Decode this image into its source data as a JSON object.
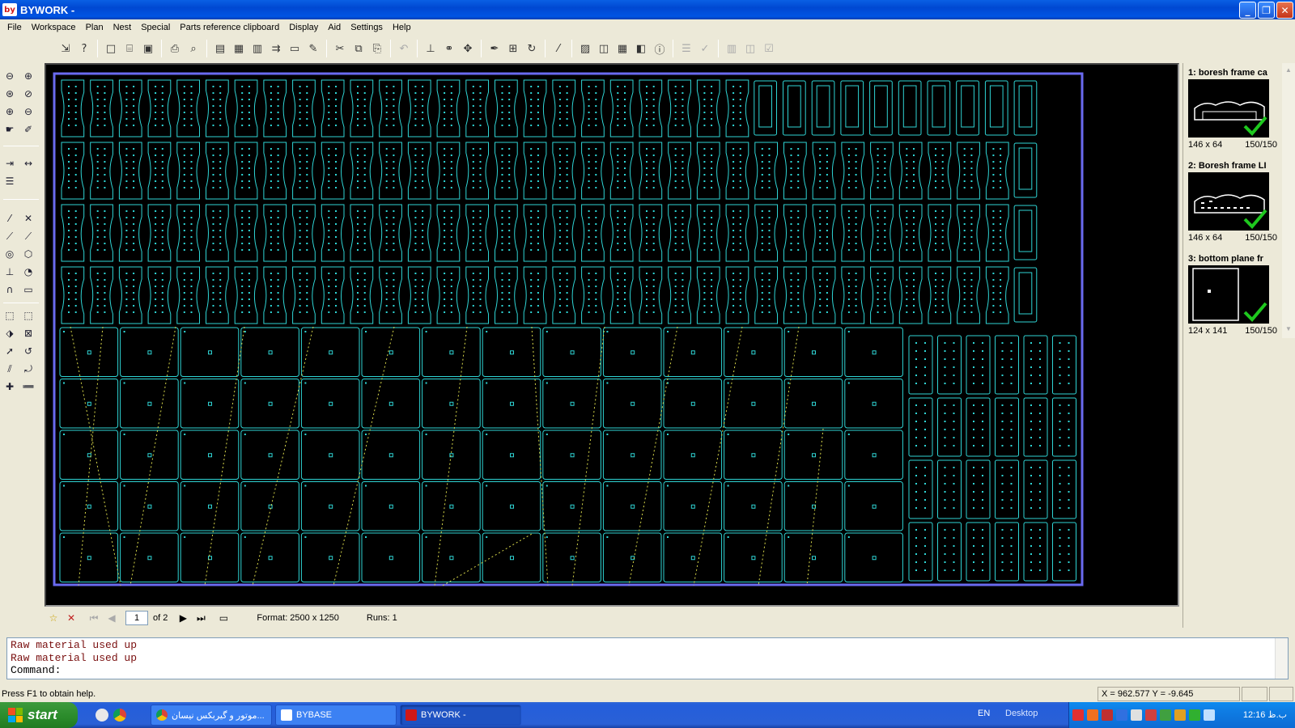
{
  "window": {
    "title": "BYWORK -",
    "logo": "by"
  },
  "menu": [
    "File",
    "Workspace",
    "Plan",
    "Nest",
    "Special",
    "Parts reference clipboard",
    "Display",
    "Aid",
    "Settings",
    "Help"
  ],
  "sheet_nav": {
    "page": "1",
    "of_label": "of 2",
    "format_label": "Format: 2500 x 1250",
    "runs_label": "Runs: 1"
  },
  "parts": [
    {
      "title": "1: boresh frame ca",
      "size": "146 x 64",
      "count": "150/150",
      "checked": true
    },
    {
      "title": "2: Boresh frame LI",
      "size": "146 x 64",
      "count": "150/150",
      "checked": true
    },
    {
      "title": "3: bottom plane fr",
      "size": "124 x 141",
      "count": "150/150",
      "checked": true
    }
  ],
  "command_lines": [
    "Raw material used up",
    "Raw material used up",
    "Command:"
  ],
  "status": {
    "help": "Press F1 to obtain help.",
    "coords": "X = 962.577   Y = -9.645"
  },
  "taskbar": {
    "start_label": "start",
    "tasks": [
      {
        "label": "موتور و گیربکس نیسان...",
        "active": false
      },
      {
        "label": "BYBASE",
        "active": false
      },
      {
        "label": "BYWORK -",
        "active": true
      }
    ],
    "lang": "EN",
    "desktop": "Desktop",
    "clock": "ب.ظ 12:16"
  },
  "colors": {
    "part_outline": "#2fd5d5",
    "sheet_border": "#6a6af0",
    "toolpath": "#d8d84a",
    "canvas_bg": "#000000",
    "check": "#1ec81e"
  }
}
